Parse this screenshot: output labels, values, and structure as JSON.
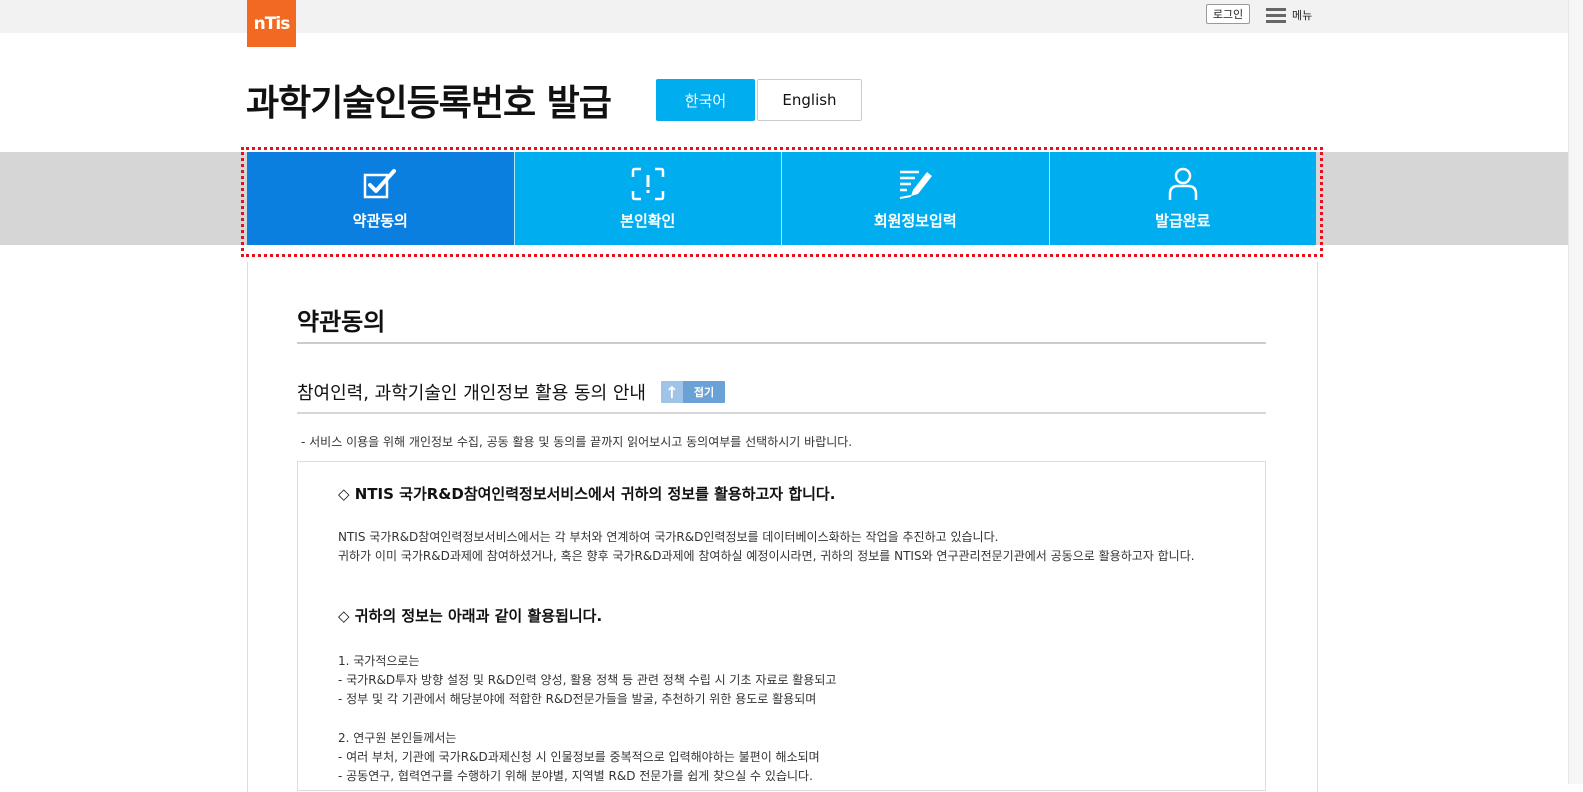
{
  "header": {
    "logo_text": "nTis",
    "login_label": "로그인",
    "menu_label": "메뉴"
  },
  "page": {
    "title": "과학기술인등록번호 발급",
    "lang_ko": "한국어",
    "lang_en": "English"
  },
  "steps": [
    {
      "label": "약관동의",
      "icon": "checkbox-check-icon",
      "active": true
    },
    {
      "label": "본인확인",
      "icon": "scan-exclamation-icon",
      "active": false
    },
    {
      "label": "회원정보입력",
      "icon": "document-pen-icon",
      "active": false
    },
    {
      "label": "발급완료",
      "icon": "person-icon",
      "active": false
    }
  ],
  "content": {
    "section_title": "약관동의",
    "sub_title": "참여인력, 과학기술인 개인정보 활용 동의 안내",
    "fold_label": "접기",
    "notice": "- 서비스 이용을 위해 개인정보 수집, 공동 활용 및 동의를 끝까지 읽어보시고 동의여부를 선택하시기 바랍니다.",
    "terms": {
      "heading1": "◇ NTIS 국가R&D참여인력정보서비스에서 귀하의 정보를 활용하고자 합니다.",
      "para1_line1": "NTIS 국가R&D참여인력정보서비스에서는 각 부처와 연계하여 국가R&D인력정보를 데이터베이스화하는 작업을 추진하고 있습니다.",
      "para1_line2": " 귀하가 이미 국가R&D과제에 참여하셨거나, 혹은 향후 국가R&D과제에 참여하실 예정이시라면, 귀하의 정보를 NTIS와 연구관리전문기관에서 공동으로 활용하고자 합니다.",
      "heading2": "◇ 귀하의 정보는 아래과 같이 활용됩니다.",
      "list1_title": "1. 국가적으로는",
      "list1_item1": " - 국가R&D투자 방향 설정 및 R&D인력 양성, 활용 정책 등 관련 정책 수립 시 기초 자료로 활용되고",
      "list1_item2": " - 정부 및 각 기관에서 해당분야에 적합한 R&D전문가들을 발굴, 추천하기 위한 용도로 활용되며",
      "list2_title": "2. 연구원 본인들께서는",
      "list2_item1": " - 여러 부처, 기관에 국가R&D과제신청 시 인물정보를 중복적으로 입력해야하는 불편이 해소되며",
      "list2_item2": " - 공동연구, 협력연구를 수행하기 위해 분야별, 지역별 R&D 전문가를 쉽게 찾으실 수 있습니다."
    }
  }
}
